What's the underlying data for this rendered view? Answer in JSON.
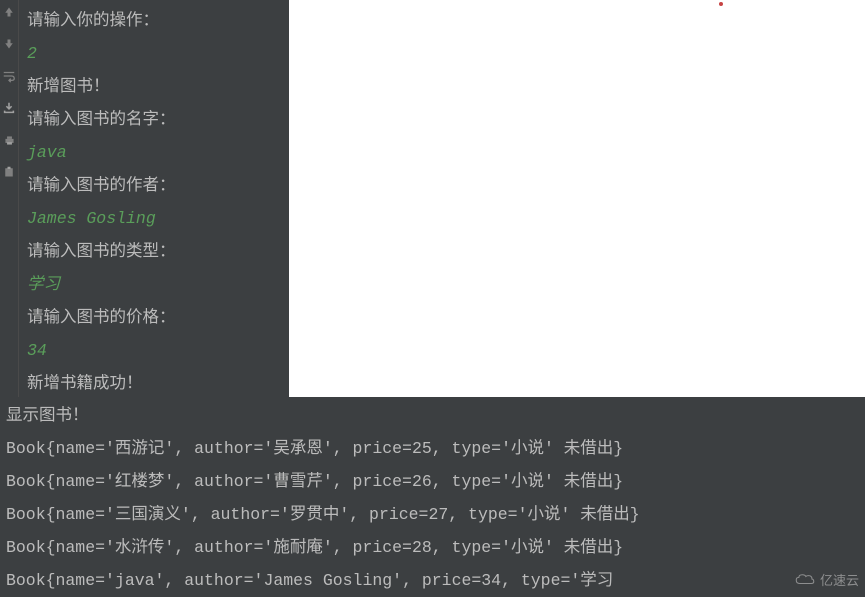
{
  "gutter": {
    "icons": [
      "arrow-up",
      "arrow-down",
      "wrap",
      "download",
      "print",
      "clipboard"
    ]
  },
  "console": {
    "prompt_operation": "请输入你的操作：",
    "input_operation": "2",
    "msg_add_book": "新增图书！",
    "prompt_name": "请输入图书的名字：",
    "input_name": "java",
    "prompt_author": "请输入图书的作者：",
    "input_author": "James Gosling",
    "prompt_type": "请输入图书的类型：",
    "input_type": "学习",
    "prompt_price": "请输入图书的价格：",
    "input_price": "34",
    "msg_success": "新增书籍成功！"
  },
  "output": {
    "header": "显示图书！",
    "books": [
      "Book{name='西游记', author='吴承恩', price=25, type='小说' 未借出}",
      "Book{name='红楼梦', author='曹雪芹', price=26, type='小说' 未借出}",
      "Book{name='三国演义', author='罗贯中', price=27, type='小说' 未借出}",
      "Book{name='水浒传', author='施耐庵', price=28, type='小说' 未借出}",
      "Book{name='java', author='James Gosling', price=34, type='学习"
    ]
  },
  "watermark": {
    "text": "亿速云"
  }
}
